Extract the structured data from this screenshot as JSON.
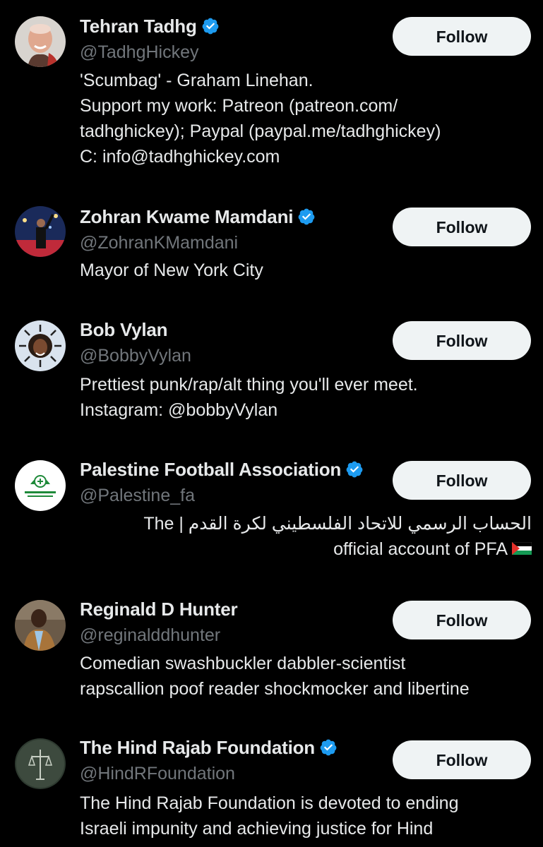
{
  "users": [
    {
      "name": "Tehran Tadhg",
      "verified": true,
      "handle": "@TadhgHickey",
      "bio": [
        "'Scumbag' - Graham Linehan.",
        "Support my work: Patreon (patreon.com/",
        "tadhghickey); Paypal (paypal.me/tadhghickey)",
        "C: info@tadhghickey.com"
      ],
      "follow_label": "Follow"
    },
    {
      "name": "Zohran Kwame Mamdani",
      "verified": true,
      "handle": "@ZohranKMamdani",
      "bio": [
        "Mayor of New York City"
      ],
      "follow_label": "Follow"
    },
    {
      "name": "Bob Vylan",
      "verified": false,
      "handle": "@BobbyVylan",
      "bio": [
        "Prettiest punk/rap/alt thing you'll ever meet.",
        "Instagram: @bobbyVylan"
      ],
      "follow_label": "Follow"
    },
    {
      "name": "Palestine Football Association",
      "verified": true,
      "handle": "@Palestine_fa",
      "bio": [
        "الحساب الرسمي للاتحاد الفلسطيني لكرة القدم | The",
        "official account of PFA"
      ],
      "follow_label": "Follow"
    },
    {
      "name": "Reginald D Hunter",
      "verified": false,
      "handle": "@reginalddhunter",
      "bio": [
        "Comedian swashbuckler dabbler-scientist",
        "rapscallion poof reader shockmocker and libertine"
      ],
      "follow_label": "Follow"
    },
    {
      "name": "The Hind Rajab Foundation",
      "verified": true,
      "handle": "@HindRFoundation",
      "bio": [
        "The Hind Rajab Foundation is devoted to ending",
        "Israeli impunity and achieving justice for Hind"
      ],
      "follow_label": "Follow"
    }
  ],
  "colors": {
    "background": "#000000",
    "text_primary": "#e7e9ea",
    "text_secondary": "#71767b",
    "verified_badge": "#1d9bf0",
    "follow_button_bg": "#eff3f4",
    "follow_button_text": "#0f1419"
  },
  "icons": {
    "verified": "verified-badge-icon",
    "flag": "palestine-flag-icon"
  }
}
